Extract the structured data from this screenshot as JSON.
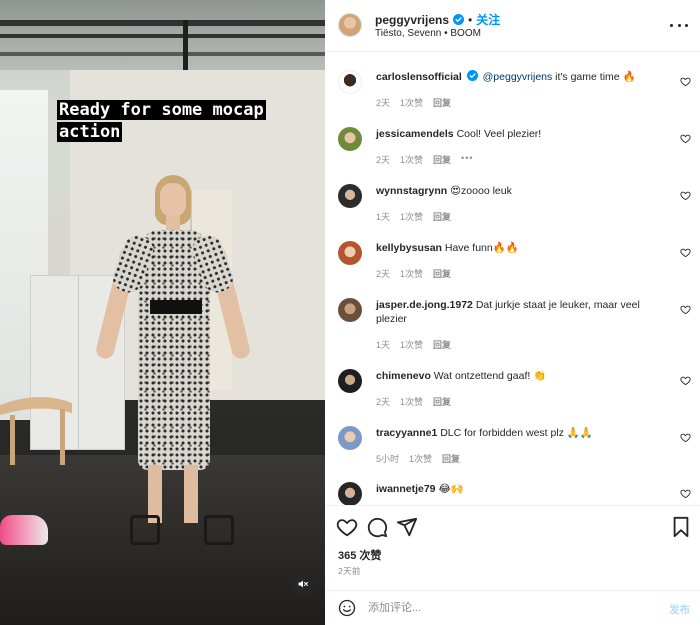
{
  "video": {
    "caption": "Ready for some mocap action",
    "mute_icon": "speaker-muted-icon"
  },
  "header": {
    "username": "peggyvrijens",
    "separator": "•",
    "follow_label": "关注",
    "music": "Tiësto, Sevenn • BOOM",
    "verified_icon": "verified-badge-icon",
    "more_icon": "more-options-icon"
  },
  "comments": [
    {
      "username": "carloslensofficial",
      "verified": true,
      "mention": "@peggyvrijens",
      "text": " it's game time 🔥",
      "time": "2天",
      "likes": "1次赞",
      "reply": "回复",
      "avatar_color": "#3b2a22"
    },
    {
      "username": "jessicamendels",
      "text": "Cool! Veel plezier!",
      "time": "2天",
      "likes": "1次赞",
      "reply": "回复",
      "more": "•••",
      "avatar_color": "#6f8b3a"
    },
    {
      "username": "wynnstagrynn",
      "text": "😍zoooo leuk",
      "time": "1天",
      "likes": "1次赞",
      "reply": "回复",
      "avatar_color": "#2c2c2c"
    },
    {
      "username": "kellybysusan",
      "text": "Have funn🔥🔥",
      "time": "2天",
      "likes": "1次赞",
      "reply": "回复",
      "avatar_color": "#b4552f"
    },
    {
      "username": "jasper.de.jong.1972",
      "text": "Dat jurkje staat je leuker, maar veel plezier",
      "time": "1天",
      "likes": "1次赞",
      "reply": "回复",
      "avatar_color": "#6b4f3d"
    },
    {
      "username": "chimenevo",
      "text": "Wat ontzettend gaaf! 👏",
      "time": "2天",
      "likes": "1次赞",
      "reply": "回复",
      "avatar_color": "#1e1e1e"
    },
    {
      "username": "tracyyanne1",
      "text": "DLC for forbidden west plz 🙏🙏",
      "time": "5小时",
      "likes": "1次赞",
      "reply": "回复",
      "avatar_color": "#7b9ac7"
    },
    {
      "username": "iwannetje79",
      "text": "😂🙌",
      "avatar_color": "#262626"
    }
  ],
  "actions": {
    "like_icon": "heart-icon",
    "comment_icon": "comment-icon",
    "share_icon": "share-icon",
    "save_icon": "bookmark-icon",
    "likes_count": "365 次赞",
    "posted": "2天前"
  },
  "composer": {
    "emoji_icon": "emoji-icon",
    "placeholder": "添加评论...",
    "post_label": "发布"
  },
  "colors": {
    "accent": "#0095f6",
    "post_disabled": "#b2dffc",
    "muted_text": "#8e8e8e"
  }
}
